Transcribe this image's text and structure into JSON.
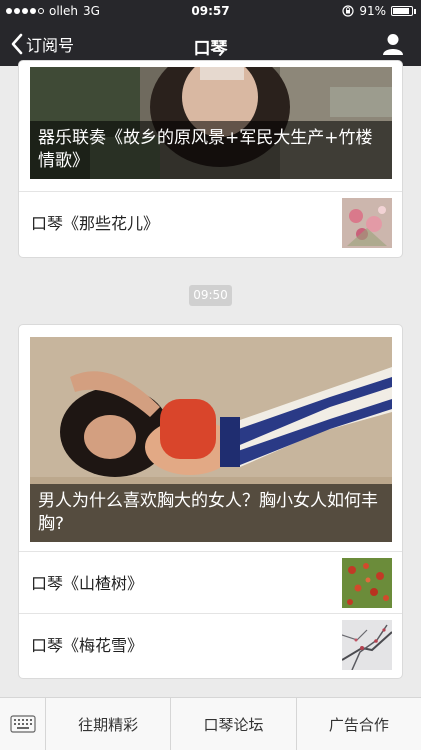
{
  "status_bar": {
    "carrier": "olleh",
    "network": "3G",
    "time": "09:57",
    "battery": "91%",
    "battery_level": 0.91
  },
  "nav": {
    "back_label": "订阅号",
    "title": "口琴"
  },
  "messages": [
    {
      "cover_title": "器乐联奏《故乡的原风景+军民大生产+竹楼情歌》",
      "items": [
        {
          "label": "口琴《那些花儿》",
          "thumb_icon": "flowers-thumbnail"
        }
      ]
    },
    {
      "timestamp": "09:50",
      "cover_title": "男人为什么喜欢胸大的女人？胸小女人如何丰胸?",
      "items": [
        {
          "label": "口琴《山楂树》",
          "thumb_icon": "hawthorn-tree-thumbnail"
        },
        {
          "label": "口琴《梅花雪》",
          "thumb_icon": "plum-blossom-snow-thumbnail"
        }
      ]
    }
  ],
  "bottom_menu": {
    "keyboard_icon": "keyboard-icon",
    "items": [
      "往期精彩",
      "口琴论坛",
      "广告合作"
    ]
  },
  "colors": {
    "nav_background": "#27272b",
    "page_background": "#ebebeb",
    "card_background": "#ffffff",
    "timestamp_badge": "#d0d0d0"
  }
}
